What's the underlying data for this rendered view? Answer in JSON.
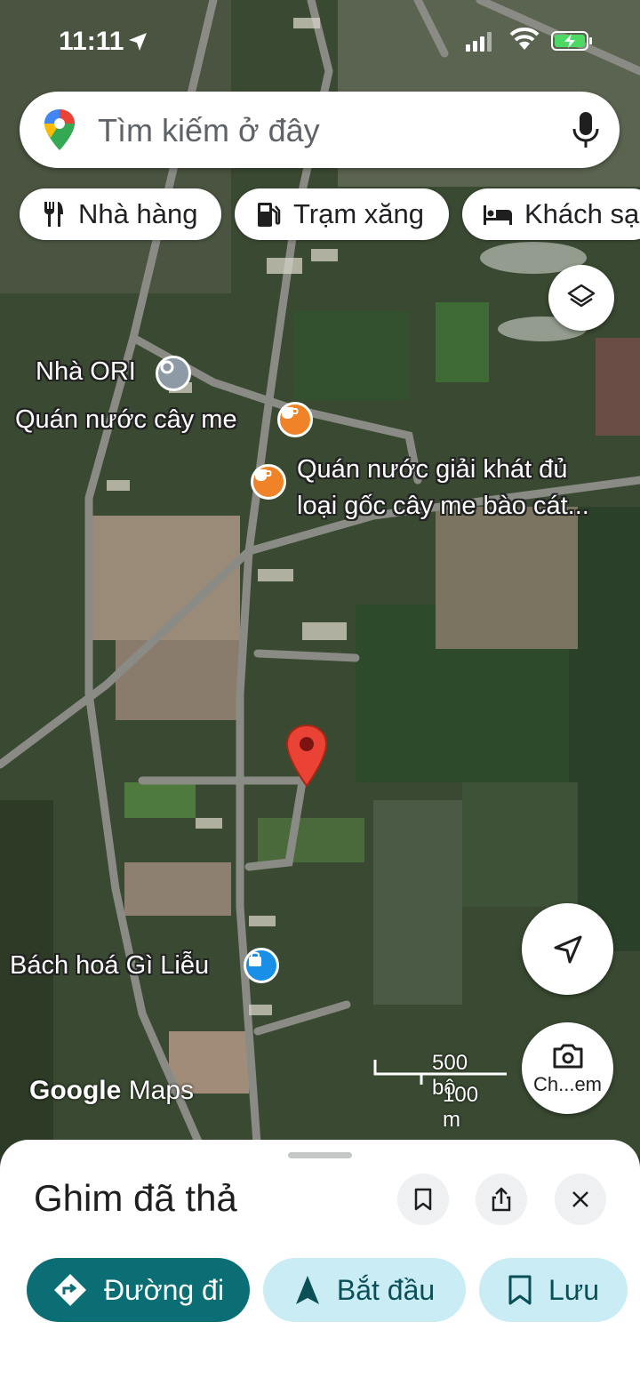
{
  "status_bar": {
    "time": "11:11"
  },
  "search": {
    "placeholder": "Tìm kiếm ở đây"
  },
  "chips": [
    {
      "label": "Nhà hàng",
      "icon": "restaurant-icon"
    },
    {
      "label": "Trạm xăng",
      "icon": "gas-station-icon"
    },
    {
      "label": "Khách sạn",
      "icon": "hotel-icon"
    }
  ],
  "map": {
    "pois": [
      {
        "name": "Nhà ORI",
        "icon": "place-icon"
      },
      {
        "name": "Quán nước cây me",
        "icon": "cafe-icon"
      },
      {
        "name_line1": "Quán nước giải khát đủ",
        "name_line2": "loại gốc cây me bào cát...",
        "icon": "cafe-icon"
      },
      {
        "name": "Bách hoá Gì Liễu",
        "icon": "shopping-bag-icon"
      }
    ],
    "logo": {
      "google": "Google",
      "maps": "Maps"
    },
    "scale": {
      "imperial": "500 bộ",
      "metric": "100 m"
    },
    "street_view_label": "Ch...em",
    "colors": {
      "pin": "#ea4335",
      "cafe": "#f08227",
      "shop": "#1a8fe8",
      "place": "#8e9aa5"
    }
  },
  "sheet": {
    "title": "Ghim đã thả",
    "actions": {
      "directions": "Đường đi",
      "start": "Bắt đầu",
      "save": "Lưu"
    },
    "colors": {
      "primary": "#0b6e75",
      "secondary_bg": "#c9ecf5"
    }
  }
}
